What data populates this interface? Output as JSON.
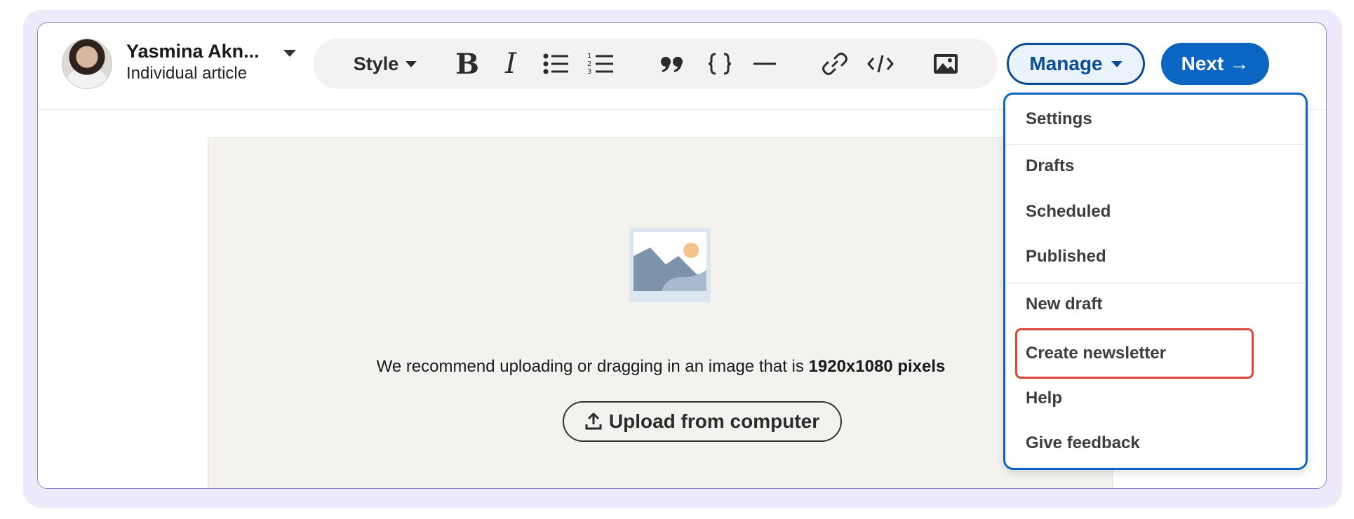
{
  "author": {
    "name": "Yasmina Akn...",
    "subtitle": "Individual article"
  },
  "toolbar": {
    "style_label": "Style",
    "bold_glyph": "B",
    "italic_glyph": "I"
  },
  "actions": {
    "manage_label": "Manage",
    "next_label": "Next",
    "next_arrow": "→"
  },
  "editor": {
    "recommend_prefix": "We recommend uploading or dragging in an image that is",
    "recommend_size": "1920x1080 pixels",
    "upload_label": "Upload from computer"
  },
  "manage_menu": {
    "items": [
      "Settings",
      "Drafts",
      "Scheduled",
      "Published",
      "New draft",
      "Create newsletter",
      "Help",
      "Give feedback"
    ],
    "highlighted": "Create newsletter"
  },
  "colors": {
    "accent": "#0a66c2",
    "manage_border": "#0a4d93",
    "highlight": "#d9473b",
    "frame": "#efeafb"
  }
}
